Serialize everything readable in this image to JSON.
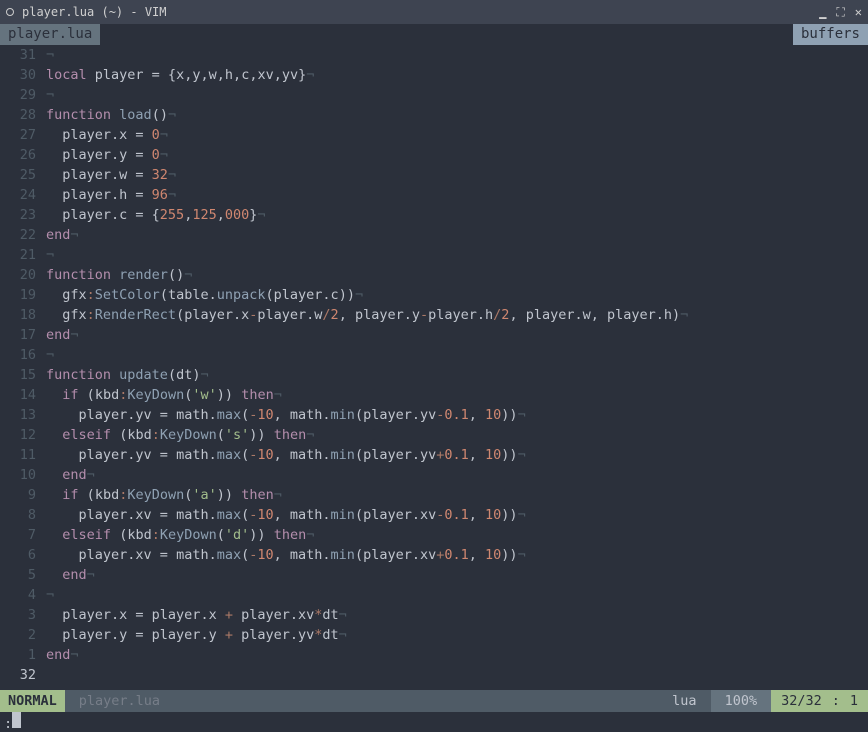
{
  "window": {
    "title": "player.lua (~) - VIM"
  },
  "tabs": {
    "active": "player.lua",
    "right": "buffers"
  },
  "editor": {
    "current_line_abs": 32,
    "lines": [
      {
        "rel": "31",
        "tokens": [
          [
            "eol",
            "¬"
          ]
        ]
      },
      {
        "rel": "30",
        "tokens": [
          [
            "kw",
            "local"
          ],
          [
            "id",
            " player "
          ],
          [
            "pn",
            "= {"
          ],
          [
            "id",
            "x"
          ],
          [
            "pn",
            ","
          ],
          [
            "id",
            "y"
          ],
          [
            "pn",
            ","
          ],
          [
            "id",
            "w"
          ],
          [
            "pn",
            ","
          ],
          [
            "id",
            "h"
          ],
          [
            "pn",
            ","
          ],
          [
            "id",
            "c"
          ],
          [
            "pn",
            ","
          ],
          [
            "id",
            "xv"
          ],
          [
            "pn",
            ","
          ],
          [
            "id",
            "yv"
          ],
          [
            "pn",
            "}"
          ],
          [
            "eol",
            "¬"
          ]
        ]
      },
      {
        "rel": "29",
        "tokens": [
          [
            "eol",
            "¬"
          ]
        ]
      },
      {
        "rel": "28",
        "tokens": [
          [
            "kw",
            "function"
          ],
          [
            "id",
            " "
          ],
          [
            "fn",
            "load"
          ],
          [
            "pn",
            "()"
          ],
          [
            "eol",
            "¬"
          ]
        ]
      },
      {
        "rel": "27",
        "tokens": [
          [
            "id",
            "  player.x "
          ],
          [
            "pn",
            "= "
          ],
          [
            "num",
            "0"
          ],
          [
            "eol",
            "¬"
          ]
        ]
      },
      {
        "rel": "26",
        "tokens": [
          [
            "id",
            "  player.y "
          ],
          [
            "pn",
            "= "
          ],
          [
            "num",
            "0"
          ],
          [
            "eol",
            "¬"
          ]
        ]
      },
      {
        "rel": "25",
        "tokens": [
          [
            "id",
            "  player.w "
          ],
          [
            "pn",
            "= "
          ],
          [
            "num",
            "32"
          ],
          [
            "eol",
            "¬"
          ]
        ]
      },
      {
        "rel": "24",
        "tokens": [
          [
            "id",
            "  player.h "
          ],
          [
            "pn",
            "= "
          ],
          [
            "num",
            "96"
          ],
          [
            "eol",
            "¬"
          ]
        ]
      },
      {
        "rel": "23",
        "tokens": [
          [
            "id",
            "  player.c "
          ],
          [
            "pn",
            "= {"
          ],
          [
            "num",
            "255"
          ],
          [
            "pn",
            ","
          ],
          [
            "num",
            "125"
          ],
          [
            "pn",
            ","
          ],
          [
            "num",
            "000"
          ],
          [
            "pn",
            "}"
          ],
          [
            "eol",
            "¬"
          ]
        ]
      },
      {
        "rel": "22",
        "tokens": [
          [
            "kw",
            "end"
          ],
          [
            "eol",
            "¬"
          ]
        ]
      },
      {
        "rel": "21",
        "tokens": [
          [
            "eol",
            "¬"
          ]
        ]
      },
      {
        "rel": "20",
        "tokens": [
          [
            "kw",
            "function"
          ],
          [
            "id",
            " "
          ],
          [
            "fn",
            "render"
          ],
          [
            "pn",
            "()"
          ],
          [
            "eol",
            "¬"
          ]
        ]
      },
      {
        "rel": "19",
        "tokens": [
          [
            "id",
            "  gfx"
          ],
          [
            "op",
            ":"
          ],
          [
            "fn",
            "SetColor"
          ],
          [
            "pn",
            "("
          ],
          [
            "id",
            "table."
          ],
          [
            "fn",
            "unpack"
          ],
          [
            "pn",
            "("
          ],
          [
            "id",
            "player.c"
          ],
          [
            "pn",
            "))"
          ],
          [
            "eol",
            "¬"
          ]
        ]
      },
      {
        "rel": "18",
        "tokens": [
          [
            "id",
            "  gfx"
          ],
          [
            "op",
            ":"
          ],
          [
            "fn",
            "RenderRect"
          ],
          [
            "pn",
            "("
          ],
          [
            "id",
            "player.x"
          ],
          [
            "op",
            "-"
          ],
          [
            "id",
            "player.w"
          ],
          [
            "op",
            "/"
          ],
          [
            "num",
            "2"
          ],
          [
            "pn",
            ", "
          ],
          [
            "id",
            "player.y"
          ],
          [
            "op",
            "-"
          ],
          [
            "id",
            "player.h"
          ],
          [
            "op",
            "/"
          ],
          [
            "num",
            "2"
          ],
          [
            "pn",
            ", "
          ],
          [
            "id",
            "player.w"
          ],
          [
            "pn",
            ", "
          ],
          [
            "id",
            "player.h"
          ],
          [
            "pn",
            ")"
          ],
          [
            "eol",
            "¬"
          ]
        ]
      },
      {
        "rel": "17",
        "tokens": [
          [
            "kw",
            "end"
          ],
          [
            "eol",
            "¬"
          ]
        ]
      },
      {
        "rel": "16",
        "tokens": [
          [
            "eol",
            "¬"
          ]
        ]
      },
      {
        "rel": "15",
        "tokens": [
          [
            "kw",
            "function"
          ],
          [
            "id",
            " "
          ],
          [
            "fn",
            "update"
          ],
          [
            "pn",
            "("
          ],
          [
            "id",
            "dt"
          ],
          [
            "pn",
            ")"
          ],
          [
            "eol",
            "¬"
          ]
        ]
      },
      {
        "rel": "14",
        "tokens": [
          [
            "id",
            "  "
          ],
          [
            "kw",
            "if"
          ],
          [
            "id",
            " "
          ],
          [
            "pn",
            "("
          ],
          [
            "id",
            "kbd"
          ],
          [
            "op",
            ":"
          ],
          [
            "fn",
            "KeyDown"
          ],
          [
            "pn",
            "("
          ],
          [
            "str",
            "'w'"
          ],
          [
            "pn",
            "))"
          ],
          [
            "id",
            " "
          ],
          [
            "kw",
            "then"
          ],
          [
            "eol",
            "¬"
          ]
        ]
      },
      {
        "rel": "13",
        "tokens": [
          [
            "id",
            "    player.yv "
          ],
          [
            "pn",
            "= "
          ],
          [
            "id",
            "math."
          ],
          [
            "fn",
            "max"
          ],
          [
            "pn",
            "("
          ],
          [
            "op",
            "-"
          ],
          [
            "num",
            "10"
          ],
          [
            "pn",
            ", "
          ],
          [
            "id",
            "math."
          ],
          [
            "fn",
            "min"
          ],
          [
            "pn",
            "("
          ],
          [
            "id",
            "player.yv"
          ],
          [
            "op",
            "-"
          ],
          [
            "num",
            "0.1"
          ],
          [
            "pn",
            ", "
          ],
          [
            "num",
            "10"
          ],
          [
            "pn",
            "))"
          ],
          [
            "eol",
            "¬"
          ]
        ]
      },
      {
        "rel": "12",
        "tokens": [
          [
            "id",
            "  "
          ],
          [
            "kw",
            "elseif"
          ],
          [
            "id",
            " "
          ],
          [
            "pn",
            "("
          ],
          [
            "id",
            "kbd"
          ],
          [
            "op",
            ":"
          ],
          [
            "fn",
            "KeyDown"
          ],
          [
            "pn",
            "("
          ],
          [
            "str",
            "'s'"
          ],
          [
            "pn",
            "))"
          ],
          [
            "id",
            " "
          ],
          [
            "kw",
            "then"
          ],
          [
            "eol",
            "¬"
          ]
        ]
      },
      {
        "rel": "11",
        "tokens": [
          [
            "id",
            "    player.yv "
          ],
          [
            "pn",
            "= "
          ],
          [
            "id",
            "math."
          ],
          [
            "fn",
            "max"
          ],
          [
            "pn",
            "("
          ],
          [
            "op",
            "-"
          ],
          [
            "num",
            "10"
          ],
          [
            "pn",
            ", "
          ],
          [
            "id",
            "math."
          ],
          [
            "fn",
            "min"
          ],
          [
            "pn",
            "("
          ],
          [
            "id",
            "player.yv"
          ],
          [
            "op",
            "+"
          ],
          [
            "num",
            "0.1"
          ],
          [
            "pn",
            ", "
          ],
          [
            "num",
            "10"
          ],
          [
            "pn",
            "))"
          ],
          [
            "eol",
            "¬"
          ]
        ]
      },
      {
        "rel": "10",
        "tokens": [
          [
            "id",
            "  "
          ],
          [
            "kw",
            "end"
          ],
          [
            "eol",
            "¬"
          ]
        ]
      },
      {
        "rel": "9",
        "tokens": [
          [
            "id",
            "  "
          ],
          [
            "kw",
            "if"
          ],
          [
            "id",
            " "
          ],
          [
            "pn",
            "("
          ],
          [
            "id",
            "kbd"
          ],
          [
            "op",
            ":"
          ],
          [
            "fn",
            "KeyDown"
          ],
          [
            "pn",
            "("
          ],
          [
            "str",
            "'a'"
          ],
          [
            "pn",
            "))"
          ],
          [
            "id",
            " "
          ],
          [
            "kw",
            "then"
          ],
          [
            "eol",
            "¬"
          ]
        ]
      },
      {
        "rel": "8",
        "tokens": [
          [
            "id",
            "    player.xv "
          ],
          [
            "pn",
            "= "
          ],
          [
            "id",
            "math."
          ],
          [
            "fn",
            "max"
          ],
          [
            "pn",
            "("
          ],
          [
            "op",
            "-"
          ],
          [
            "num",
            "10"
          ],
          [
            "pn",
            ", "
          ],
          [
            "id",
            "math."
          ],
          [
            "fn",
            "min"
          ],
          [
            "pn",
            "("
          ],
          [
            "id",
            "player.xv"
          ],
          [
            "op",
            "-"
          ],
          [
            "num",
            "0.1"
          ],
          [
            "pn",
            ", "
          ],
          [
            "num",
            "10"
          ],
          [
            "pn",
            "))"
          ],
          [
            "eol",
            "¬"
          ]
        ]
      },
      {
        "rel": "7",
        "tokens": [
          [
            "id",
            "  "
          ],
          [
            "kw",
            "elseif"
          ],
          [
            "id",
            " "
          ],
          [
            "pn",
            "("
          ],
          [
            "id",
            "kbd"
          ],
          [
            "op",
            ":"
          ],
          [
            "fn",
            "KeyDown"
          ],
          [
            "pn",
            "("
          ],
          [
            "str",
            "'d'"
          ],
          [
            "pn",
            "))"
          ],
          [
            "id",
            " "
          ],
          [
            "kw",
            "then"
          ],
          [
            "eol",
            "¬"
          ]
        ]
      },
      {
        "rel": "6",
        "tokens": [
          [
            "id",
            "    player.xv "
          ],
          [
            "pn",
            "= "
          ],
          [
            "id",
            "math."
          ],
          [
            "fn",
            "max"
          ],
          [
            "pn",
            "("
          ],
          [
            "op",
            "-"
          ],
          [
            "num",
            "10"
          ],
          [
            "pn",
            ", "
          ],
          [
            "id",
            "math."
          ],
          [
            "fn",
            "min"
          ],
          [
            "pn",
            "("
          ],
          [
            "id",
            "player.xv"
          ],
          [
            "op",
            "+"
          ],
          [
            "num",
            "0.1"
          ],
          [
            "pn",
            ", "
          ],
          [
            "num",
            "10"
          ],
          [
            "pn",
            "))"
          ],
          [
            "eol",
            "¬"
          ]
        ]
      },
      {
        "rel": "5",
        "tokens": [
          [
            "id",
            "  "
          ],
          [
            "kw",
            "end"
          ],
          [
            "eol",
            "¬"
          ]
        ]
      },
      {
        "rel": "4",
        "tokens": [
          [
            "eol",
            "¬"
          ]
        ]
      },
      {
        "rel": "3",
        "tokens": [
          [
            "id",
            "  player.x "
          ],
          [
            "pn",
            "= "
          ],
          [
            "id",
            "player.x "
          ],
          [
            "op",
            "+"
          ],
          [
            "id",
            " player.xv"
          ],
          [
            "op",
            "*"
          ],
          [
            "id",
            "dt"
          ],
          [
            "eol",
            "¬"
          ]
        ]
      },
      {
        "rel": "2",
        "tokens": [
          [
            "id",
            "  player.y "
          ],
          [
            "pn",
            "= "
          ],
          [
            "id",
            "player.y "
          ],
          [
            "op",
            "+"
          ],
          [
            "id",
            " player.yv"
          ],
          [
            "op",
            "*"
          ],
          [
            "id",
            "dt"
          ],
          [
            "eol",
            "¬"
          ]
        ]
      },
      {
        "rel": "1",
        "tokens": [
          [
            "kw",
            "end"
          ],
          [
            "eol",
            "¬"
          ]
        ]
      },
      {
        "rel": "32",
        "current": true,
        "tokens": [
          [
            "id",
            ""
          ]
        ]
      }
    ]
  },
  "status": {
    "mode": "NORMAL",
    "file": "player.lua",
    "filetype": "lua",
    "percent": "100%",
    "lines": "32/32",
    "sep": ":",
    "col": "1"
  },
  "cmdline": ":"
}
